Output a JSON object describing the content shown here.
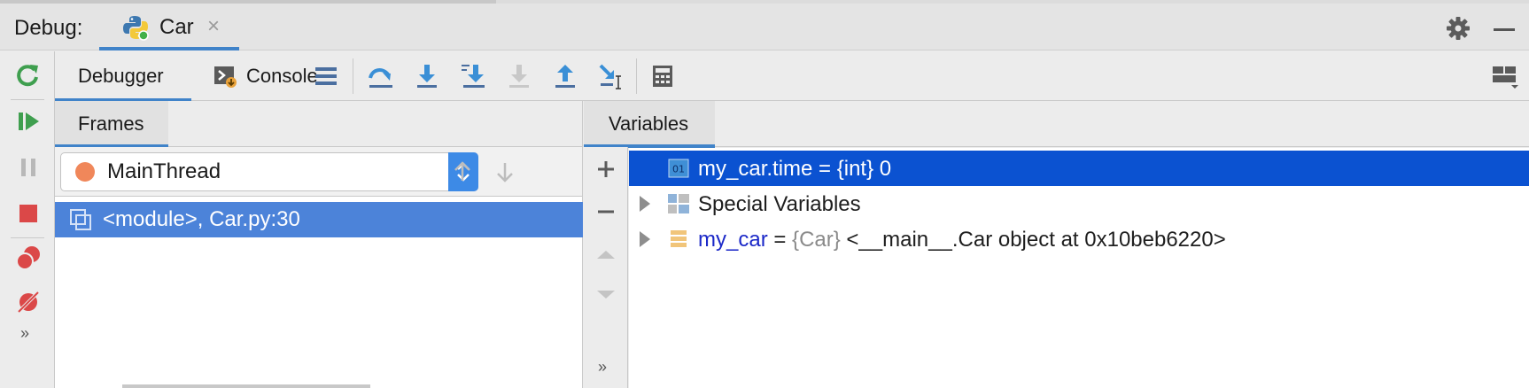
{
  "title_bar": {
    "debug_label": "Debug:",
    "run_tab_label": "Car",
    "close_glyph": "×",
    "icons": [
      "python-icon",
      "close-icon",
      "gear-icon",
      "minimize-icon"
    ]
  },
  "toolbar": {
    "tabs": [
      {
        "label": "Debugger",
        "active": true
      },
      {
        "label": "Console",
        "active": false
      }
    ],
    "actions": [
      "show-execution-point",
      "step-over",
      "step-into",
      "step-into-my-code",
      "force-step-into",
      "step-out",
      "run-to-cursor",
      "evaluate-expression",
      "restore-layout"
    ]
  },
  "left_rail": {
    "actions": [
      "rerun",
      "resume",
      "pause",
      "stop",
      "view-breakpoints",
      "mute-breakpoints"
    ],
    "more": "»"
  },
  "frames": {
    "tab_label": "Frames",
    "thread": "MainThread",
    "items": [
      {
        "text": "<module>, Car.py:30",
        "selected": true
      }
    ]
  },
  "variables": {
    "tab_label": "Variables",
    "more": "»",
    "rows": [
      {
        "icon": "int-icon",
        "text": "my_car.time = {int} 0",
        "selected": true,
        "expandable": false
      },
      {
        "icon": "special-vars-icon",
        "text": "Special Variables",
        "selected": false,
        "expandable": true
      },
      {
        "icon": "object-icon",
        "name": "my_car",
        "eq": " = ",
        "type": "{Car}",
        "value": " <__main__.Car object at 0x10beb6220>",
        "selected": false,
        "expandable": true
      }
    ]
  },
  "colors": {
    "accent": "#4083c9",
    "selection": "#0b52d1",
    "frame_selection": "#4c83d9",
    "thread_dot": "#f0875a",
    "rerun": "#3f9f4f",
    "stop": "#db4848"
  }
}
